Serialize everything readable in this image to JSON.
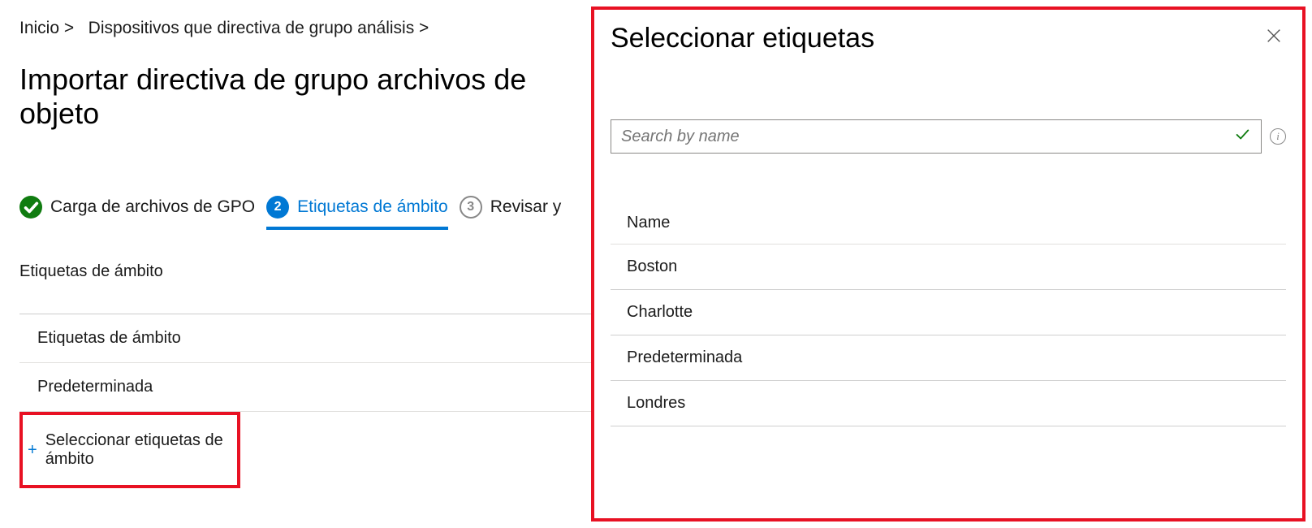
{
  "breadcrumb": {
    "item1": "Inicio",
    "sep": "&gt;",
    "item2": "Dispositivos que directiva de grupo análisis",
    "sep2": "&gt;"
  },
  "page_title": "Importar directiva de grupo archivos de objeto",
  "wizard": {
    "step1": "Carga de archivos de GPO",
    "step2": "Etiquetas de ámbito",
    "step2_num": "2",
    "step3": "Revisar y",
    "step3_num": "3"
  },
  "section_label": "Etiquetas de ámbito",
  "table_header": "Etiquetas de ámbito",
  "table_row1": "Predeterminada",
  "add_link_label": "Seleccionar etiquetas de ámbito",
  "panel": {
    "title": "Seleccionar etiquetas",
    "search_placeholder": "Search by name",
    "column_header": "Name",
    "items": {
      "0": "Boston",
      "1": "Charlotte",
      "2": "Predeterminada",
      "3": "Londres"
    }
  }
}
